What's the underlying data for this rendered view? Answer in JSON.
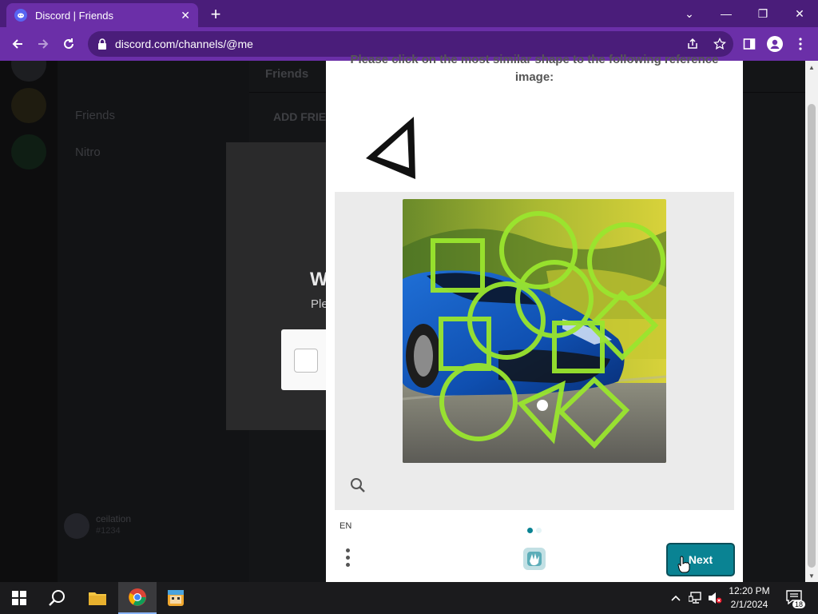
{
  "browser": {
    "tab_title": "Discord | Friends",
    "tab_close": "✕",
    "new_tab": "+",
    "url": "discord.com/channels/@me",
    "window_controls": {
      "chevron": "⌄",
      "minimize": "—",
      "restore": "❐",
      "close": "✕"
    }
  },
  "discord_bg": {
    "sidebar_items": [
      "Friends",
      "Nitro"
    ],
    "top_tab": "Friends",
    "add_friend": "ADD FRIEND",
    "username": "ceilation",
    "user_sub": "#1234",
    "modal_title": "W",
    "modal_subtitle": "Ple"
  },
  "captcha": {
    "prompt": "Please click on the most similar shape to the following reference image:",
    "reference_shape": "triangle",
    "language": "EN",
    "next_label": "Next",
    "page_indicator": {
      "current": 1,
      "total": 2
    }
  },
  "taskbar": {
    "time": "12:20 PM",
    "date": "2/1/2024",
    "notifications": "18"
  },
  "colors": {
    "browser_frame": "#4a1d7a",
    "browser_toolbar": "#6b2fa8",
    "captcha_accent": "#0a8393",
    "shape_outline": "#9ae62e"
  }
}
